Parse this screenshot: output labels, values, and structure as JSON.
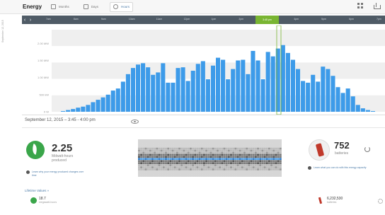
{
  "header": {
    "title": "Energy",
    "tabs": [
      {
        "label": "Months"
      },
      {
        "label": "Days"
      },
      {
        "label": "Hours"
      }
    ]
  },
  "timeline": {
    "ticks": [
      "7am",
      "8am",
      "9am",
      "10am",
      "11am",
      "12pm",
      "1pm",
      "2pm",
      "3pm",
      "4pm",
      "5pm",
      "6pm",
      "7pm"
    ],
    "selected": "3:45 pm"
  },
  "chart_data": {
    "type": "bar",
    "ylabel": "September 12, 2015",
    "yticks": [
      "2.00 MW",
      "1.50 MW",
      "1.00 MW",
      "500 kW",
      "0 W"
    ],
    "ylim": [
      0,
      2.4
    ],
    "values": [
      0.0,
      0.02,
      0.05,
      0.08,
      0.12,
      0.15,
      0.2,
      0.28,
      0.35,
      0.42,
      0.5,
      0.62,
      0.68,
      0.88,
      1.1,
      1.28,
      1.38,
      1.42,
      1.3,
      1.08,
      1.15,
      1.42,
      0.85,
      0.85,
      1.28,
      1.3,
      0.9,
      1.2,
      1.4,
      1.48,
      0.95,
      1.35,
      1.58,
      1.52,
      0.95,
      1.25,
      1.5,
      1.52,
      1.1,
      1.78,
      1.5,
      0.95,
      1.75,
      1.62,
      1.85,
      1.95,
      1.72,
      1.52,
      1.25,
      0.9,
      0.85,
      1.08,
      0.88,
      1.32,
      1.25,
      1.05,
      0.72,
      0.55,
      0.68,
      0.45,
      0.2,
      0.1,
      0.05,
      0.02
    ]
  },
  "detail": {
    "date_range": "September 12, 2015 – 3:45 - 4:00 pm",
    "energy_value": "2.25",
    "energy_unit": "Mdwatt-hours produced",
    "energy_note": "Learn why your energy produced changes over time",
    "batteries_value": "752",
    "batteries_unit": "batteries",
    "batteries_note": "Learn what you can do with this energy capacity",
    "lifetime_label": "Lifetime Values »",
    "lifetime_energy_value": "18.7",
    "lifetime_energy_unit": "megawatt-hours",
    "lifetime_batteries_value": "6,232,530",
    "lifetime_batteries_unit": "batteries"
  }
}
